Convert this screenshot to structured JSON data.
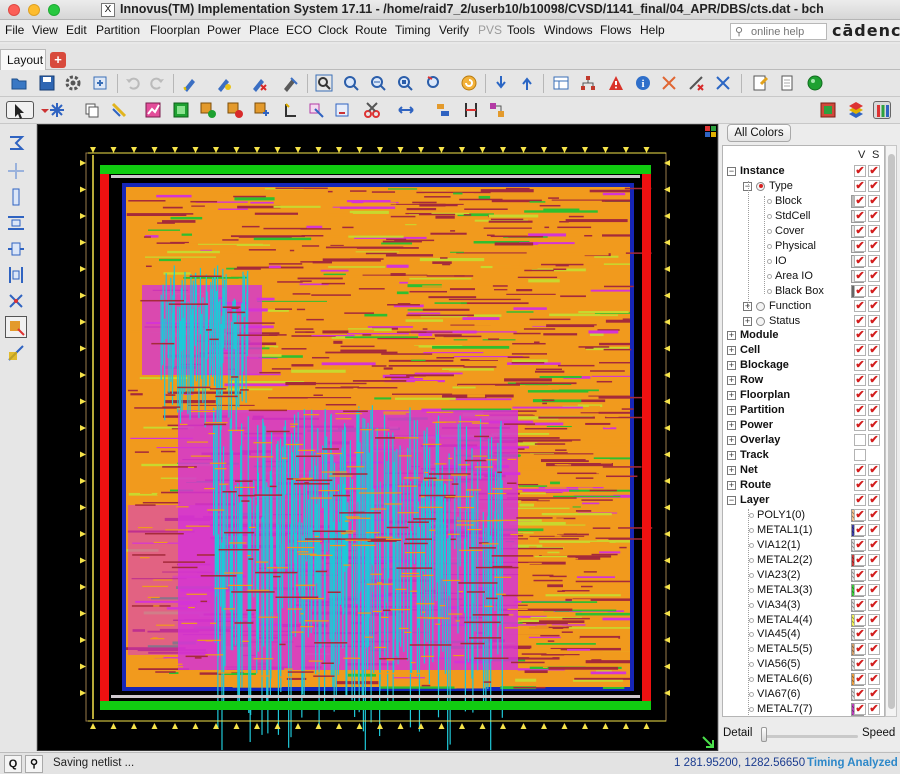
{
  "window": {
    "title": "Innovus(TM) Implementation System 17.11 - /home/raid7_2/userb10/b10098/CVSD/1141_final/04_APR/DBS/cts.dat - bch",
    "title_icon": "X"
  },
  "menu": [
    "File",
    "View",
    "Edit",
    "Partition",
    "Floorplan",
    "Power",
    "Place",
    "ECO",
    "Clock",
    "Route",
    "Timing",
    "Verify",
    "PVS",
    "Tools",
    "Windows",
    "Flows",
    "Help"
  ],
  "menu_disabled": [
    "PVS"
  ],
  "search": {
    "placeholder": "online help"
  },
  "brand": "cādence",
  "tabs": [
    {
      "label": "Layout"
    }
  ],
  "right_panel": {
    "all_colors_label": "All Colors",
    "col_v": "V",
    "col_s": "S",
    "tree": [
      {
        "label": "Instance",
        "level": 0,
        "bold": true,
        "expander": "minus",
        "v": true,
        "s": true
      },
      {
        "label": "Type",
        "level": 1,
        "expander": "minus",
        "radio": "on",
        "v": true,
        "s": true
      },
      {
        "label": "Block",
        "level": 2,
        "swatch": "#bcbcbc",
        "v": true,
        "s": true
      },
      {
        "label": "StdCell",
        "level": 2,
        "swatch": "#e6e6e6",
        "v": true,
        "s": true
      },
      {
        "label": "Cover",
        "level": 2,
        "swatch": "#e6e6e6",
        "v": true,
        "s": true
      },
      {
        "label": "Physical",
        "level": 2,
        "swatch": "#e6e6e6",
        "v": true,
        "s": true
      },
      {
        "label": "IO",
        "level": 2,
        "swatch": "#e6e6e6",
        "v": true,
        "s": true
      },
      {
        "label": "Area IO",
        "level": 2,
        "swatch": "#e6e6e6",
        "v": true,
        "s": true
      },
      {
        "label": "Black Box",
        "level": 2,
        "swatch": "#666666",
        "v": true,
        "s": true
      },
      {
        "label": "Function",
        "level": 1,
        "expander": "plus",
        "radio": "off",
        "v": true,
        "s": true
      },
      {
        "label": "Status",
        "level": 1,
        "expander": "plus",
        "radio": "off",
        "v": true,
        "s": true
      },
      {
        "label": "Module",
        "level": 0,
        "bold": true,
        "expander": "plus",
        "v": true,
        "s": true
      },
      {
        "label": "Cell",
        "level": 0,
        "bold": true,
        "expander": "plus",
        "v": true,
        "s": true
      },
      {
        "label": "Blockage",
        "level": 0,
        "bold": true,
        "expander": "plus",
        "v": true,
        "s": true
      },
      {
        "label": "Row",
        "level": 0,
        "bold": true,
        "expander": "plus",
        "v": true,
        "s": true
      },
      {
        "label": "Floorplan",
        "level": 0,
        "bold": true,
        "expander": "plus",
        "v": true,
        "s": true
      },
      {
        "label": "Partition",
        "level": 0,
        "bold": true,
        "expander": "plus",
        "v": true,
        "s": true
      },
      {
        "label": "Power",
        "level": 0,
        "bold": true,
        "expander": "plus",
        "v": true,
        "s": true
      },
      {
        "label": "Overlay",
        "level": 0,
        "bold": true,
        "expander": "plus",
        "v": false,
        "s": true
      },
      {
        "label": "Track",
        "level": 0,
        "bold": true,
        "expander": "plus",
        "v": false,
        "s": null
      },
      {
        "label": "Net",
        "level": 0,
        "bold": true,
        "expander": "plus",
        "v": true,
        "s": true
      },
      {
        "label": "Route",
        "level": 0,
        "bold": true,
        "expander": "plus",
        "v": true,
        "s": true
      },
      {
        "label": "Layer",
        "level": 0,
        "bold": true,
        "expander": "minus",
        "v": true,
        "s": true
      },
      {
        "label": "POLY1(0)",
        "level": 1,
        "dot": true,
        "swatch": "#f7c38f",
        "v": true,
        "s": true
      },
      {
        "label": "METAL1(1)",
        "level": 1,
        "dot": true,
        "swatch": "#3c3caa",
        "v": true,
        "s": true
      },
      {
        "label": "VIA12(1)",
        "level": 1,
        "dot": true,
        "swatch": "#e0e0e0",
        "v": true,
        "s": true
      },
      {
        "label": "METAL2(2)",
        "level": 1,
        "dot": true,
        "swatch": "#d23a3a",
        "v": true,
        "s": true
      },
      {
        "label": "VIA23(2)",
        "level": 1,
        "dot": true,
        "swatch": "#e0e0e0",
        "v": true,
        "s": true
      },
      {
        "label": "METAL3(3)",
        "level": 1,
        "dot": true,
        "swatch": "#3bd03b",
        "v": true,
        "s": true
      },
      {
        "label": "VIA34(3)",
        "level": 1,
        "dot": true,
        "swatch": "#e0e0e0",
        "v": true,
        "s": true
      },
      {
        "label": "METAL4(4)",
        "level": 1,
        "dot": true,
        "swatch": "#f3f35a",
        "v": true,
        "s": true
      },
      {
        "label": "VIA45(4)",
        "level": 1,
        "dot": true,
        "swatch": "#e0e0e0",
        "v": true,
        "s": true
      },
      {
        "label": "METAL5(5)",
        "level": 1,
        "dot": true,
        "swatch": "#d5a06a",
        "v": true,
        "s": true
      },
      {
        "label": "VIA56(5)",
        "level": 1,
        "dot": true,
        "swatch": "#e0e0e0",
        "v": true,
        "s": true
      },
      {
        "label": "METAL6(6)",
        "level": 1,
        "dot": true,
        "swatch": "#f0a040",
        "v": true,
        "s": true
      },
      {
        "label": "VIA67(6)",
        "level": 1,
        "dot": true,
        "swatch": "#e0e0e0",
        "v": true,
        "s": true
      },
      {
        "label": "METAL7(7)",
        "level": 1,
        "dot": true,
        "swatch": "#c040c0",
        "v": true,
        "s": true
      }
    ],
    "detail_label": "Detail",
    "speed_label": "Speed"
  },
  "status": {
    "q_button": "Q",
    "message": "Saving netlist ...",
    "coords": "1  281.95200, 1282.56650",
    "timing": "Timing Analyzed"
  },
  "colors": {
    "core_magenta": "#d534d5",
    "core_cyan": "#1fc8d8",
    "core_orange": "#f19a1d",
    "core_maroon": "#a52a3a",
    "core_blue": "#1626b8",
    "ring_red": "#ee1111",
    "ring_green": "#11cc11",
    "pin_yellow": "#f5e34a"
  }
}
